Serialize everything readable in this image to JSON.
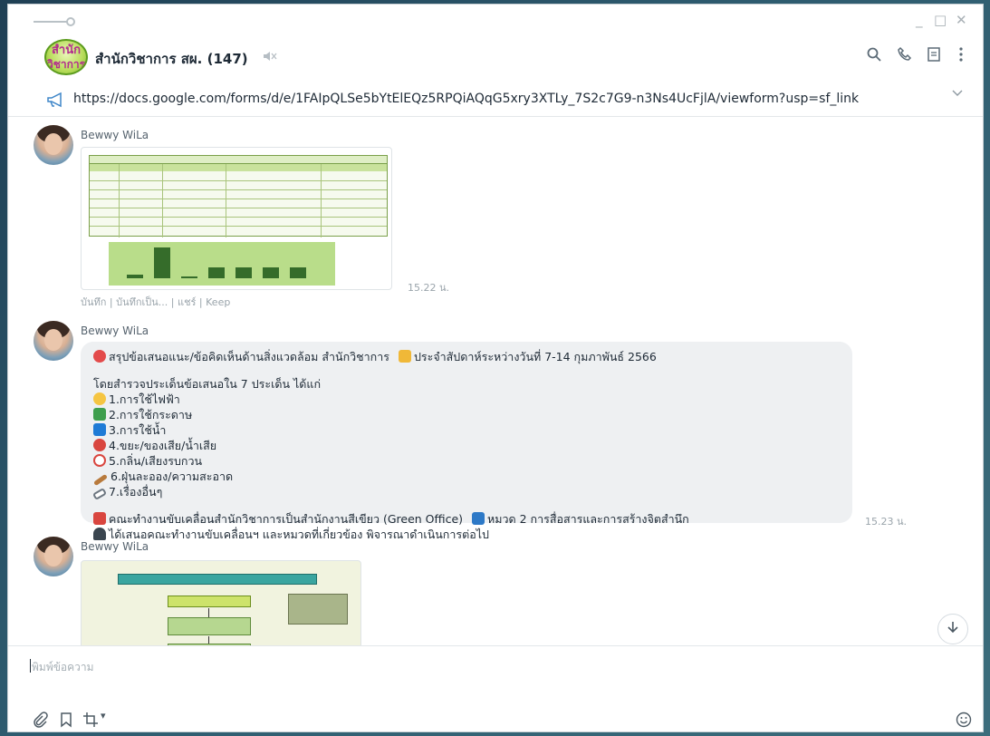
{
  "window": {
    "controls": {
      "minimize": "_",
      "maximize": "□",
      "close": "✕"
    }
  },
  "header": {
    "group_avatar_line1": "สำนัก",
    "group_avatar_line2": "วิชาการ",
    "title": "สำนักวิชาการ สผ. (147)",
    "icons": [
      "search-icon",
      "phone-icon",
      "notes-icon",
      "more-icon"
    ]
  },
  "announcement": {
    "icon": "megaphone-icon",
    "text": "https://docs.google.com/forms/d/e/1FAIpQLSe5bYtElEQz5RPQiAQqG5xry3XTLy_7S2c7G9-n3Ns4UcFjlA/viewform?usp=sf_link"
  },
  "messages": [
    {
      "sender": "Bewwy WiLa",
      "type": "image",
      "time": "15.22 น.",
      "actions": "บันทึก | บันทึกเป็น... | แชร์ | Keep"
    },
    {
      "sender": "Bewwy WiLa",
      "type": "text",
      "time": "15.23 น.",
      "lines": [
        "สรุปข้อเสนอแนะ/ข้อคิดเห็นด้านสิ่งแวดล้อม สำนักวิชาการ",
        "ประจำสัปดาห์ระหว่างวันที่ 7-14 กุมภาพันธ์ 2566",
        "โดยสำรวจประเด็นข้อเสนอใน 7 ประเด็น ได้แก่",
        "1.การใช้ไฟฟ้า",
        "2.การใช้กระดาษ",
        "3.การใช้น้ำ",
        "4.ขยะ/ของเสีย/น้ำเสีย",
        "5.กลิ่น/เสียงรบกวน",
        "6.ฝุ่นละออง/ความสะอาด",
        "7.เรื่องอื่นๆ",
        "คณะทำงานขับเคลื่อนสำนักวิชาการเป็นสำนักงานสีเขียว (Green Office)",
        "หมวด 2 การสื่อสารและการสร้างจิตสำนึก",
        "ได้เสนอคณะทำงานขับเคลื่อนฯ และหมวดที่เกี่ยวข้อง พิจารณาดำเนินการต่อไป"
      ]
    },
    {
      "sender": "Bewwy WiLa",
      "type": "image"
    }
  ],
  "input": {
    "placeholder": "พิมพ์ข้อความ"
  },
  "toolbar": {
    "icons": [
      "attach-icon",
      "bookmark-icon",
      "crop-icon",
      "emoji-icon"
    ],
    "dropdown_mark": "▾"
  },
  "colors": {
    "accent_green": "#7aa04a",
    "bubble_bg": "#eef0f2"
  }
}
